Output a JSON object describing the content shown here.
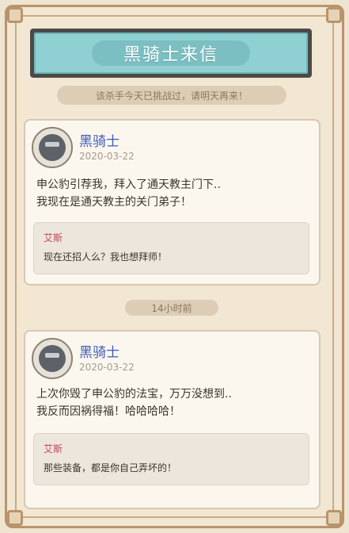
{
  "header": {
    "title": "黑骑士来信"
  },
  "notice": {
    "text": "该杀手今天已挑战过，请明天再来！"
  },
  "letters": [
    {
      "sender": "黑骑士",
      "date": "2020-03-22",
      "message_lines": [
        "申公豹引荐我，拜入了通天教主门下..",
        "我现在是通天教主的关门弟子！"
      ],
      "reply": {
        "author": "艾斯",
        "text": "现在还招人么？我也想拜师！"
      }
    },
    {
      "sender": "黑骑士",
      "date": "2020-03-22",
      "message_lines": [
        "上次你毁了申公豹的法宝，万万没想到..",
        "我反而因祸得福！哈哈哈哈！"
      ],
      "reply": {
        "author": "艾斯",
        "text": "那些装备，都是你自己弄坏的！"
      }
    }
  ],
  "divider": {
    "time_ago": "14小时前"
  },
  "colors": {
    "title_plate": "#8fd0d2",
    "sender_name": "#3f5bb5",
    "reply_author": "#c2475a",
    "background": "#efe4cf"
  },
  "icons": {
    "avatar": "black-knight-avatar"
  }
}
